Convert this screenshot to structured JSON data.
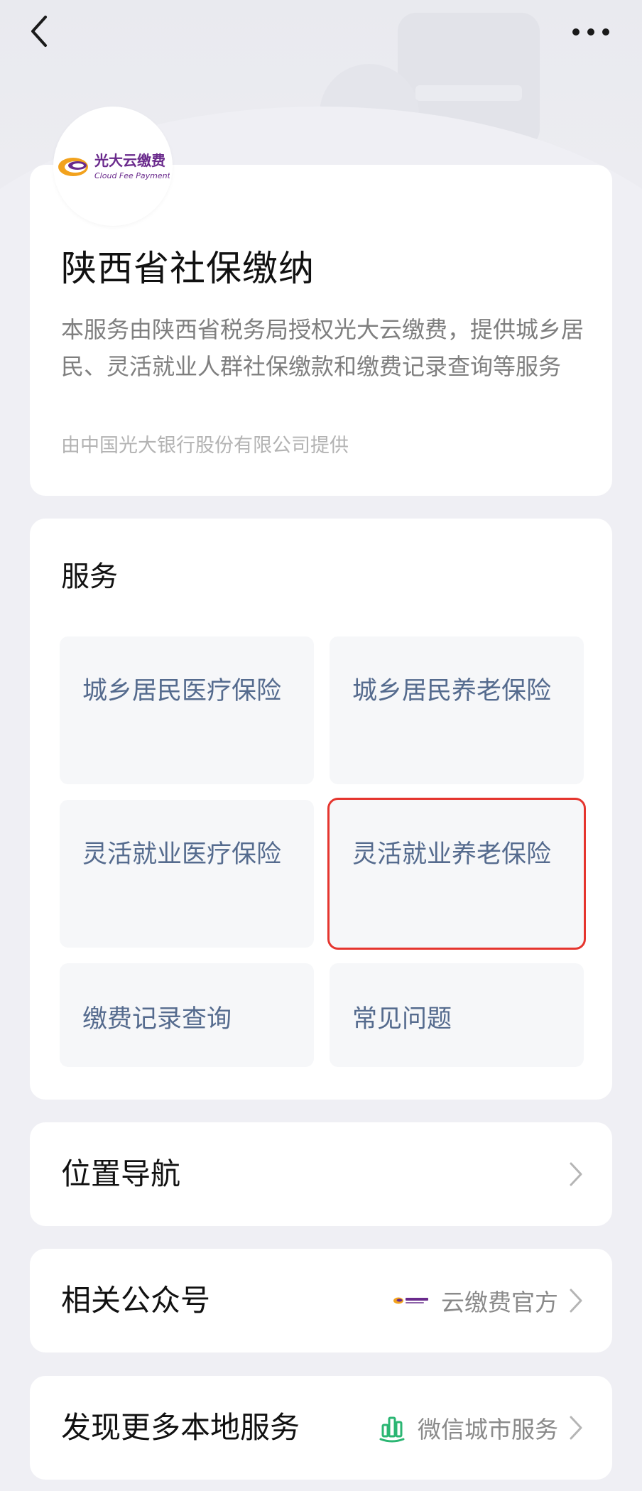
{
  "header": {
    "back_icon": "chevron-left-icon",
    "more_icon": "more-dots-icon"
  },
  "brand": {
    "logo_text_cn": "光大云缴费",
    "logo_text_en": "Cloud Fee Payment",
    "colors": {
      "purple": "#6a2a8c",
      "orange": "#f2a21d"
    }
  },
  "info": {
    "title": "陕西省社保缴纳",
    "description": "本服务由陕西省税务局授权光大云缴费，提供城乡居民、灵活就业人群社保缴款和缴费记录查询等服务",
    "provider": "由中国光大银行股份有限公司提供"
  },
  "services": {
    "title": "服务",
    "tiles": [
      {
        "label": "城乡居民医疗保险"
      },
      {
        "label": "城乡居民养老保险"
      },
      {
        "label": "灵活就业医疗保险"
      },
      {
        "label": "灵活就业养老保险"
      },
      {
        "label": "缴费记录查询"
      },
      {
        "label": "常见问题"
      }
    ],
    "highlight_color": "#e5352e"
  },
  "rows": {
    "nav": {
      "label": "位置导航"
    },
    "official": {
      "label": "相关公众号",
      "value": "云缴费官方"
    },
    "more": {
      "label": "发现更多本地服务",
      "value": "微信城市服务",
      "value_icon": "city-building-icon",
      "icon_color": "#2bb673"
    }
  }
}
